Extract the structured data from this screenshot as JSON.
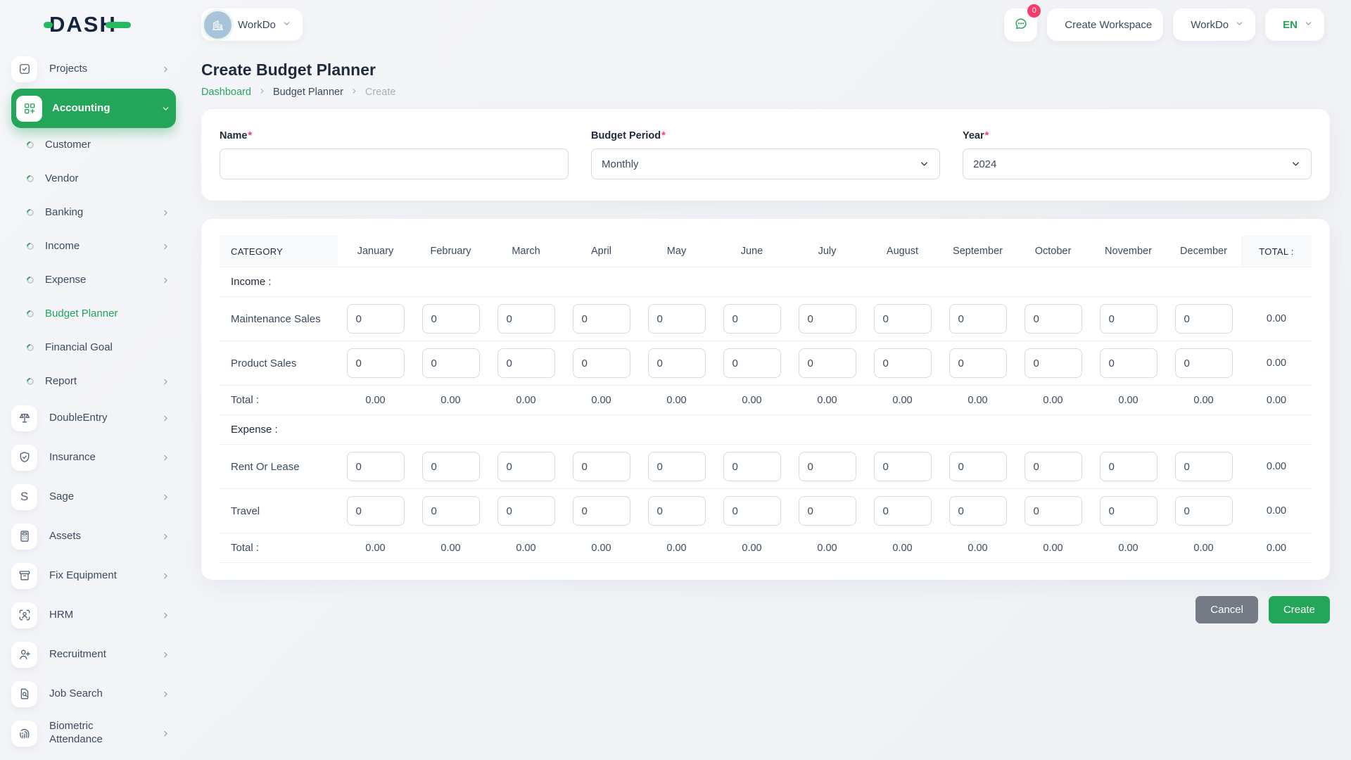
{
  "brand": {
    "name": "DASH"
  },
  "topbar": {
    "workspace_name": "WorkDo",
    "chat_badge": "0",
    "create_workspace_label": "Create Workspace",
    "workspace_menu_label": "WorkDo",
    "language_code": "EN"
  },
  "sidebar": {
    "items": [
      {
        "label": "Projects",
        "icon": "checkbox",
        "level": "top",
        "chevron": "right",
        "active": false
      },
      {
        "label": "Accounting",
        "icon": "grid-plus",
        "level": "top",
        "chevron": "down",
        "active": true
      },
      {
        "label": "Customer",
        "icon": "ring",
        "level": "sub",
        "chevron": "",
        "active": false
      },
      {
        "label": "Vendor",
        "icon": "ring",
        "level": "sub",
        "chevron": "",
        "active": false
      },
      {
        "label": "Banking",
        "icon": "ring",
        "level": "sub",
        "chevron": "right",
        "active": false
      },
      {
        "label": "Income",
        "icon": "ring",
        "level": "sub",
        "chevron": "right",
        "active": false
      },
      {
        "label": "Expense",
        "icon": "ring",
        "level": "sub",
        "chevron": "right",
        "active": false
      },
      {
        "label": "Budget Planner",
        "icon": "ring",
        "level": "sub",
        "chevron": "",
        "active": true
      },
      {
        "label": "Financial Goal",
        "icon": "ring",
        "level": "sub",
        "chevron": "",
        "active": false
      },
      {
        "label": "Report",
        "icon": "ring",
        "level": "sub",
        "chevron": "right",
        "active": false
      },
      {
        "label": "DoubleEntry",
        "icon": "scales",
        "level": "top",
        "chevron": "right",
        "active": false
      },
      {
        "label": "Insurance",
        "icon": "shield-check",
        "level": "top",
        "chevron": "right",
        "active": false
      },
      {
        "label": "Sage",
        "icon": "letter-s",
        "level": "top",
        "chevron": "right",
        "active": false
      },
      {
        "label": "Assets",
        "icon": "calculator",
        "level": "top",
        "chevron": "right",
        "active": false
      },
      {
        "label": "Fix Equipment",
        "icon": "archive-box",
        "level": "top",
        "chevron": "right",
        "active": false
      },
      {
        "label": "HRM",
        "icon": "user-focus",
        "level": "top",
        "chevron": "right",
        "active": false
      },
      {
        "label": "Recruitment",
        "icon": "user-plus",
        "level": "top",
        "chevron": "right",
        "active": false
      },
      {
        "label": "Job Search",
        "icon": "file-search",
        "level": "top",
        "chevron": "right",
        "active": false
      },
      {
        "label": "Biometric Attendance",
        "icon": "fingerprint",
        "level": "top",
        "chevron": "right",
        "active": false
      }
    ]
  },
  "page": {
    "title": "Create Budget Planner",
    "breadcrumb": [
      "Dashboard",
      "Budget Planner",
      "Create"
    ]
  },
  "form": {
    "fields": {
      "name": {
        "label": "Name",
        "required": "*",
        "value": "",
        "placeholder": ""
      },
      "period": {
        "label": "Budget Period",
        "required": "*",
        "value": "Monthly"
      },
      "year": {
        "label": "Year",
        "required": "*",
        "value": "2024"
      }
    }
  },
  "budget_table": {
    "category_header": "CATEGORY",
    "months": [
      "January",
      "February",
      "March",
      "April",
      "May",
      "June",
      "July",
      "August",
      "September",
      "October",
      "November",
      "December"
    ],
    "total_header": "TOTAL :",
    "total_row_label": "Total :",
    "sections": [
      {
        "label": "Income :",
        "rows": [
          {
            "name": "Maintenance Sales",
            "values": [
              "0",
              "0",
              "0",
              "0",
              "0",
              "0",
              "0",
              "0",
              "0",
              "0",
              "0",
              "0"
            ],
            "total": "0.00"
          },
          {
            "name": "Product Sales",
            "values": [
              "0",
              "0",
              "0",
              "0",
              "0",
              "0",
              "0",
              "0",
              "0",
              "0",
              "0",
              "0"
            ],
            "total": "0.00"
          }
        ],
        "column_totals": [
          "0.00",
          "0.00",
          "0.00",
          "0.00",
          "0.00",
          "0.00",
          "0.00",
          "0.00",
          "0.00",
          "0.00",
          "0.00",
          "0.00"
        ],
        "grand_total": "0.00"
      },
      {
        "label": "Expense :",
        "rows": [
          {
            "name": "Rent Or Lease",
            "values": [
              "0",
              "0",
              "0",
              "0",
              "0",
              "0",
              "0",
              "0",
              "0",
              "0",
              "0",
              "0"
            ],
            "total": "0.00"
          },
          {
            "name": "Travel",
            "values": [
              "0",
              "0",
              "0",
              "0",
              "0",
              "0",
              "0",
              "0",
              "0",
              "0",
              "0",
              "0"
            ],
            "total": "0.00"
          }
        ],
        "column_totals": [
          "0.00",
          "0.00",
          "0.00",
          "0.00",
          "0.00",
          "0.00",
          "0.00",
          "0.00",
          "0.00",
          "0.00",
          "0.00",
          "0.00"
        ],
        "grand_total": "0.00"
      }
    ]
  },
  "actions": {
    "cancel_label": "Cancel",
    "create_label": "Create"
  },
  "colors": {
    "primary_green": "#24a65a",
    "badge_red": "#f73b6c",
    "cancel_gray": "#757b85",
    "logo_navy": "#14263f"
  }
}
